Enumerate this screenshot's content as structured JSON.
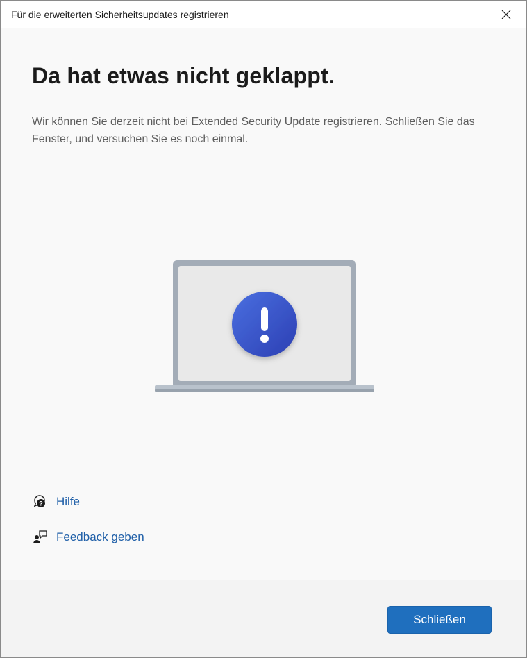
{
  "window": {
    "title": "Für die erweiterten Sicherheitsupdates registrieren",
    "close_icon": "close-icon"
  },
  "main": {
    "heading": "Da hat etwas nicht geklappt.",
    "description": "Wir können Sie derzeit nicht bei Extended Security Update registrieren. Schließen Sie das Fenster, und versuchen Sie es noch einmal.",
    "illustration": {
      "icon": "laptop-warning-icon",
      "badge_color": "#3856c9",
      "badge_symbol": "!"
    }
  },
  "links": [
    {
      "label": "Hilfe",
      "icon": "help-chat-icon"
    },
    {
      "label": "Feedback geben",
      "icon": "feedback-icon"
    }
  ],
  "footer": {
    "close_button_label": "Schließen",
    "accent_color": "#1f6fbe"
  }
}
